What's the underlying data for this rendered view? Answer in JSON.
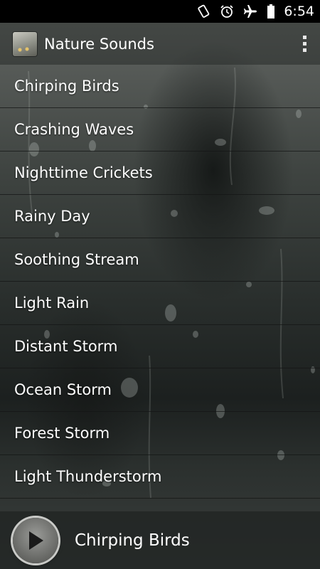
{
  "status_bar": {
    "time": "6:54",
    "icons": [
      "screen-rotation-icon",
      "alarm-icon",
      "airplane-mode-icon",
      "battery-icon"
    ]
  },
  "action_bar": {
    "title": "Nature Sounds",
    "icon": "app-logo-icon",
    "menu_icon": "overflow-menu-icon"
  },
  "sounds": [
    {
      "label": "Chirping Birds"
    },
    {
      "label": "Crashing Waves"
    },
    {
      "label": "Nighttime Crickets"
    },
    {
      "label": "Rainy Day"
    },
    {
      "label": "Soothing Stream"
    },
    {
      "label": "Light Rain"
    },
    {
      "label": "Distant Storm"
    },
    {
      "label": "Ocean Storm"
    },
    {
      "label": "Forest Storm"
    },
    {
      "label": "Light Thunderstorm"
    }
  ],
  "player": {
    "now_playing": "Chirping Birds",
    "play_icon": "play-icon"
  }
}
